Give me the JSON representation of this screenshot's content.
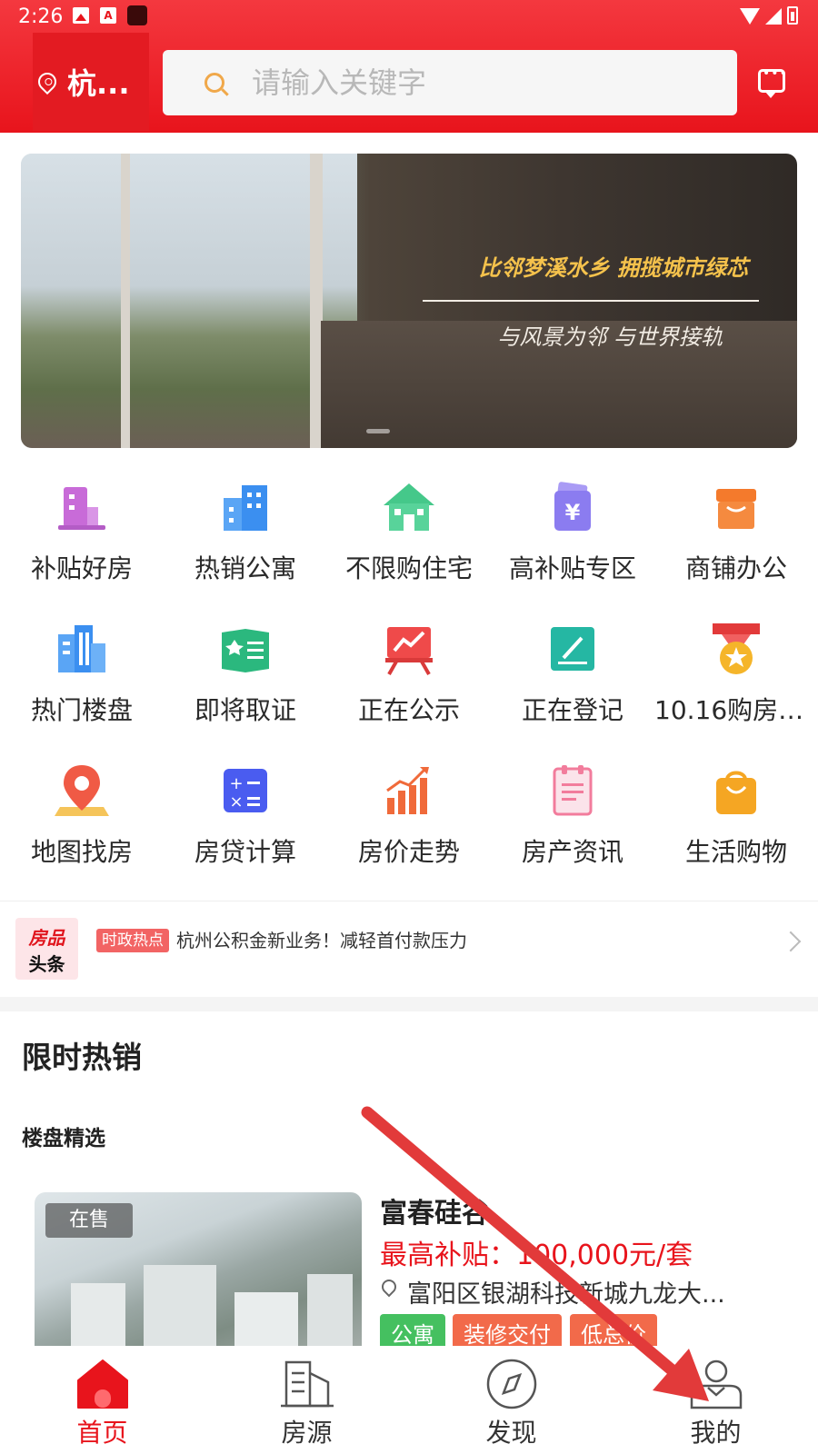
{
  "status_bar": {
    "time": "2:26"
  },
  "header": {
    "location": "杭...",
    "search_placeholder": "请输入关键字"
  },
  "banner": {
    "slogan": "比邻梦溪水乡 拥揽城市绿芯",
    "subtitle": "与风景为邻 与世界接轨"
  },
  "grid": {
    "rows": [
      [
        {
          "label": "补贴好房",
          "icon": "subsidy-building-icon",
          "color": "#c86bd8"
        },
        {
          "label": "热销公寓",
          "icon": "apartment-icon",
          "color": "#3b8ff0"
        },
        {
          "label": "不限购住宅",
          "icon": "house-icon",
          "color": "#45c88a"
        },
        {
          "label": "高补贴专区",
          "icon": "yuan-wallet-icon",
          "color": "#8b7cf0"
        },
        {
          "label": "商铺办公",
          "icon": "shop-icon",
          "color": "#f47a2c"
        }
      ],
      [
        {
          "label": "热门楼盘",
          "icon": "tower-icon",
          "color": "#3b8ff0"
        },
        {
          "label": "即将取证",
          "icon": "certificate-icon",
          "color": "#2bb87e"
        },
        {
          "label": "正在公示",
          "icon": "board-chart-icon",
          "color": "#ef4a4a"
        },
        {
          "label": "正在登记",
          "icon": "edit-icon",
          "color": "#25b7a3"
        },
        {
          "label": "10.16购房新...",
          "icon": "medal-icon",
          "color": "#f5b52a"
        }
      ],
      [
        {
          "label": "地图找房",
          "icon": "map-pin-icon",
          "color": "#f05a45"
        },
        {
          "label": "房贷计算",
          "icon": "calculator-icon",
          "color": "#4a5cf0"
        },
        {
          "label": "房价走势",
          "icon": "trend-icon",
          "color": "#f06a3a"
        },
        {
          "label": "房产资讯",
          "icon": "news-clipboard-icon",
          "color": "#f27c9c"
        },
        {
          "label": "生活购物",
          "icon": "shopping-bag-icon",
          "color": "#f5a623"
        }
      ]
    ]
  },
  "news": {
    "logo_line1": "房品",
    "logo_line2": "头条",
    "tag": "时政热点",
    "title": "杭州公积金新业务！减轻首付款压力"
  },
  "section": {
    "title": "限时热销",
    "subtitle": "楼盘精选"
  },
  "property": {
    "badge": "在售",
    "name": "富春硅谷",
    "subsidy": "最高补贴：100,000元/套",
    "address": "富阳区银湖科技新城九龙大...",
    "tags": [
      {
        "label": "公寓",
        "color": "#45c060"
      },
      {
        "label": "装修交付",
        "color": "#f26a4a"
      },
      {
        "label": "低总价",
        "color": "#f26a4a"
      }
    ]
  },
  "tabbar": {
    "tabs": [
      {
        "label": "首页",
        "active": true
      },
      {
        "label": "房源",
        "active": false
      },
      {
        "label": "发现",
        "active": false
      },
      {
        "label": "我的",
        "active": false
      }
    ]
  },
  "colors": {
    "brand": "#e8141c",
    "arrow": "#e23a3a"
  }
}
